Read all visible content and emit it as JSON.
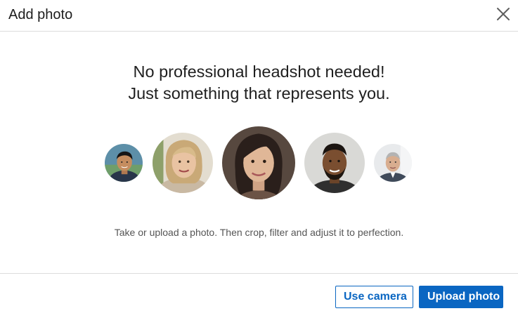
{
  "modal": {
    "title": "Add photo",
    "close_icon": "close-icon"
  },
  "content": {
    "headline_line1": "No professional headshot needed!",
    "headline_line2": "Just something that represents you.",
    "caption": "Take or upload a photo. Then crop, filter and adjust it to perfection.",
    "avatars": [
      {
        "icon": "person-photo"
      },
      {
        "icon": "person-photo"
      },
      {
        "icon": "person-photo"
      },
      {
        "icon": "person-photo"
      },
      {
        "icon": "person-photo"
      }
    ]
  },
  "footer": {
    "use_camera_label": "Use camera",
    "upload_photo_label": "Upload photo"
  },
  "colors": {
    "accent": "#0a66c2",
    "divider": "#dcdcdc",
    "text": "#1f1f1f",
    "muted": "#555555"
  }
}
